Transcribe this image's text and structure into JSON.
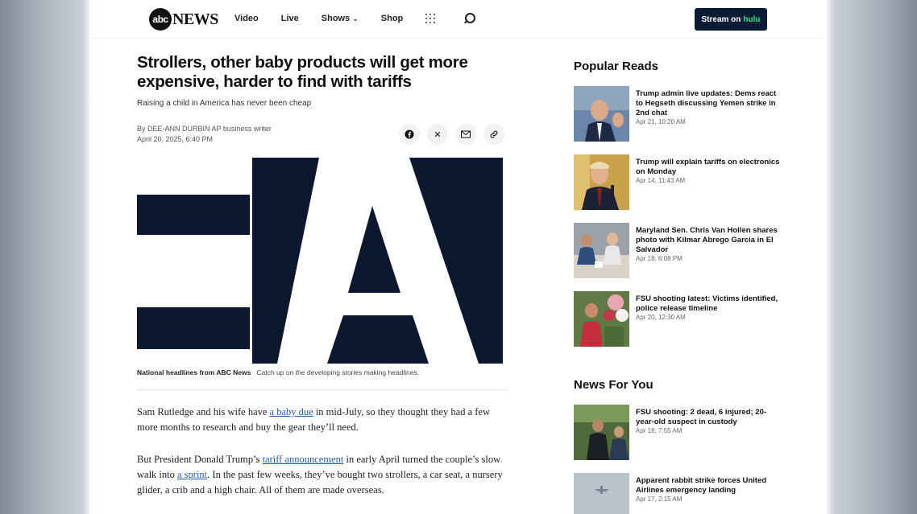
{
  "header": {
    "logo_mark": "abc",
    "logo_word": "NEWS",
    "nav": [
      "Video",
      "Live",
      "Shows",
      "Shop"
    ],
    "stream_label": "Stream on",
    "stream_brand": "hulu"
  },
  "article": {
    "headline": "Strollers, other baby products will get more expensive, harder to find with tariffs",
    "subhead": "Raising a child in America has never been cheap",
    "byline": "By DEE-ANN DURBIN AP business writer",
    "date": "April 20, 2025, 6:40 PM",
    "caption_bold": "National headlines from ABC News",
    "caption_text": "Catch up on the developing stories making headlines.",
    "p1_a": "Sam Rutledge and his wife have ",
    "p1_link": "a baby due",
    "p1_b": " in mid-July, so they thought they had a few more months to research and buy the gear they’ll need.",
    "p2_a": "But President Donald Trump’s ",
    "p2_link1": "tariff announcement",
    "p2_b": " in early April turned the couple’s slow walk into ",
    "p2_link2": "a sprint",
    "p2_c": ". In the past few weeks, they’ve bought two strollers, a car seat, a nursery glider, a crib and a high chair. All of them are made overseas."
  },
  "sidebar": {
    "popular_title": "Popular Reads",
    "popular": [
      {
        "title": "Trump admin live updates: Dems react to Hegseth discussing Yemen strike in 2nd chat",
        "date": "Apr 21, 10:20 AM"
      },
      {
        "title": "Trump will explain tariffs on electronics on Monday",
        "date": "Apr 14, 11:43 AM"
      },
      {
        "title": "Maryland Sen. Chris Van Hollen shares photo with Kilmar Abrego Garcia in El Salvador",
        "date": "Apr 18, 6:08 PM"
      },
      {
        "title": "FSU shooting latest: Victims identified, police release timeline",
        "date": "Apr 20, 12:30 AM"
      }
    ],
    "news_title": "News For You",
    "news": [
      {
        "title": "FSU shooting: 2 dead, 6 injured; 20-year-old suspect in custody",
        "date": "Apr 18, 7:55 AM"
      },
      {
        "title": "Apparent rabbit strike forces United Airlines emergency landing",
        "date": "Apr 17, 2:15 AM"
      }
    ]
  },
  "colors": {
    "brand_dark": "#0b1b33",
    "hulu_green": "#1ce783",
    "link": "#1f5fa8"
  },
  "icons": [
    "facebook-icon",
    "x-icon",
    "mail-icon",
    "link-icon",
    "grid-icon",
    "search-icon",
    "chevron-down-icon"
  ]
}
